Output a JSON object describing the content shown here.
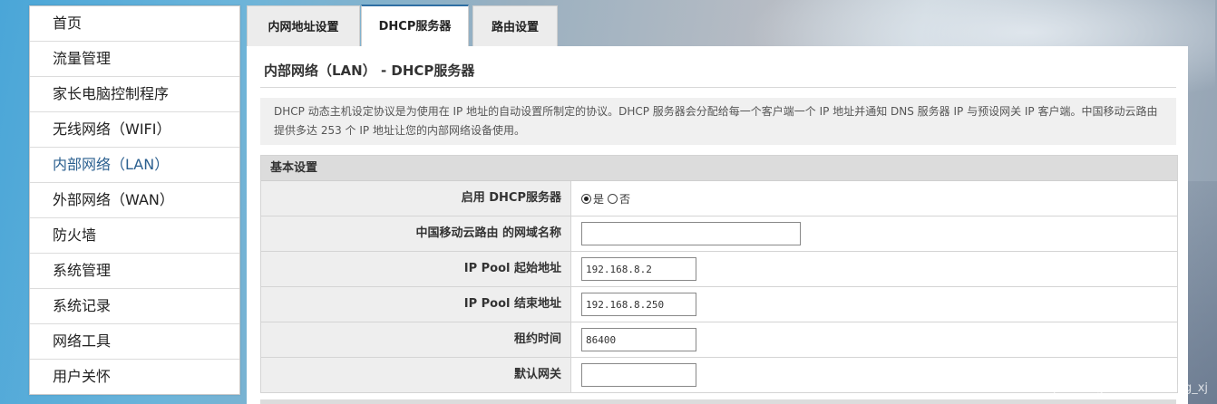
{
  "sidebar": {
    "items": [
      {
        "label": "首页"
      },
      {
        "label": "流量管理"
      },
      {
        "label": "家长电脑控制程序"
      },
      {
        "label": "无线网络（WIFI）"
      },
      {
        "label": "内部网络（LAN）"
      },
      {
        "label": "外部网络（WAN）"
      },
      {
        "label": "防火墙"
      },
      {
        "label": "系统管理"
      },
      {
        "label": "系统记录"
      },
      {
        "label": "网络工具"
      },
      {
        "label": "用户关怀"
      }
    ],
    "active_index": 4
  },
  "tabs": [
    {
      "label": "内网地址设置"
    },
    {
      "label": "DHCP服务器"
    },
    {
      "label": "路由设置"
    }
  ],
  "active_tab": 1,
  "page": {
    "title": "内部网络（LAN） - DHCP服务器",
    "description": "DHCP 动态主机设定协议是为使用在 IP 地址的自动设置所制定的协议。DHCP 服务器会分配给每一个客户端一个 IP 地址并通知 DNS 服务器 IP 与预设网关 IP 客户端。中国移动云路由 提供多达 253 个 IP 地址让您的内部网络设备使用。"
  },
  "settings": {
    "section_title": "基本设置",
    "enable_dhcp": {
      "label": "启用 DHCP服务器",
      "yes": "是",
      "no": "否",
      "selected": "yes"
    },
    "domain_name": {
      "label": "中国移动云路由 的网域名称",
      "value": ""
    },
    "pool_start": {
      "label": "IP Pool 起始地址",
      "value": "192.168.8.2"
    },
    "pool_end": {
      "label": "IP Pool 结束地址",
      "value": "192.168.8.250"
    },
    "lease_time": {
      "label": "租约时间",
      "value": "86400"
    },
    "gateway": {
      "label": "默认网关",
      "value": ""
    }
  },
  "watermark": "https://blog.csdn.net/dang_xj",
  "colors": {
    "accent": "#2f6fa3",
    "active_nav": "#2a5f8f"
  }
}
